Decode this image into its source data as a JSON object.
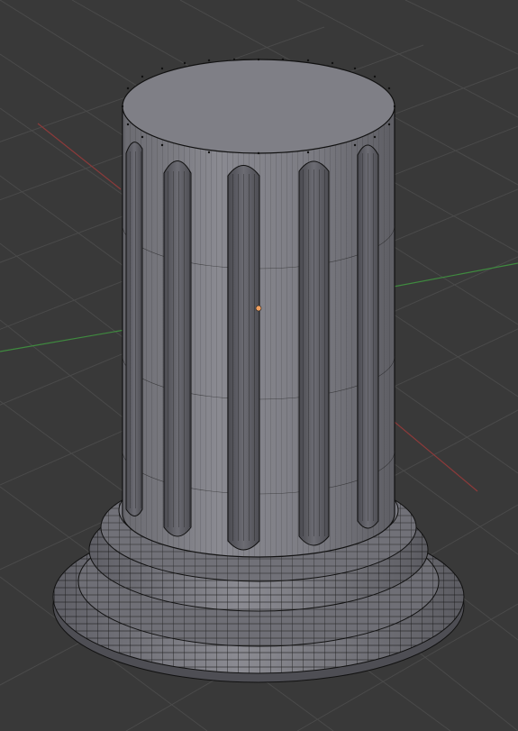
{
  "viewport": {
    "view": "3d-viewport",
    "mode": "edit-mode-wireframe-overlay",
    "object": "fluted-column-with-base",
    "background_color": "#393939",
    "grid_color": "#4a4a4a",
    "x_axis_color": "#8c3a3a",
    "y_axis_color": "#3f8a3f",
    "mesh_face_color": "#7f7f86",
    "mesh_edge_color": "#111111",
    "origin_color": "#f0a060"
  }
}
